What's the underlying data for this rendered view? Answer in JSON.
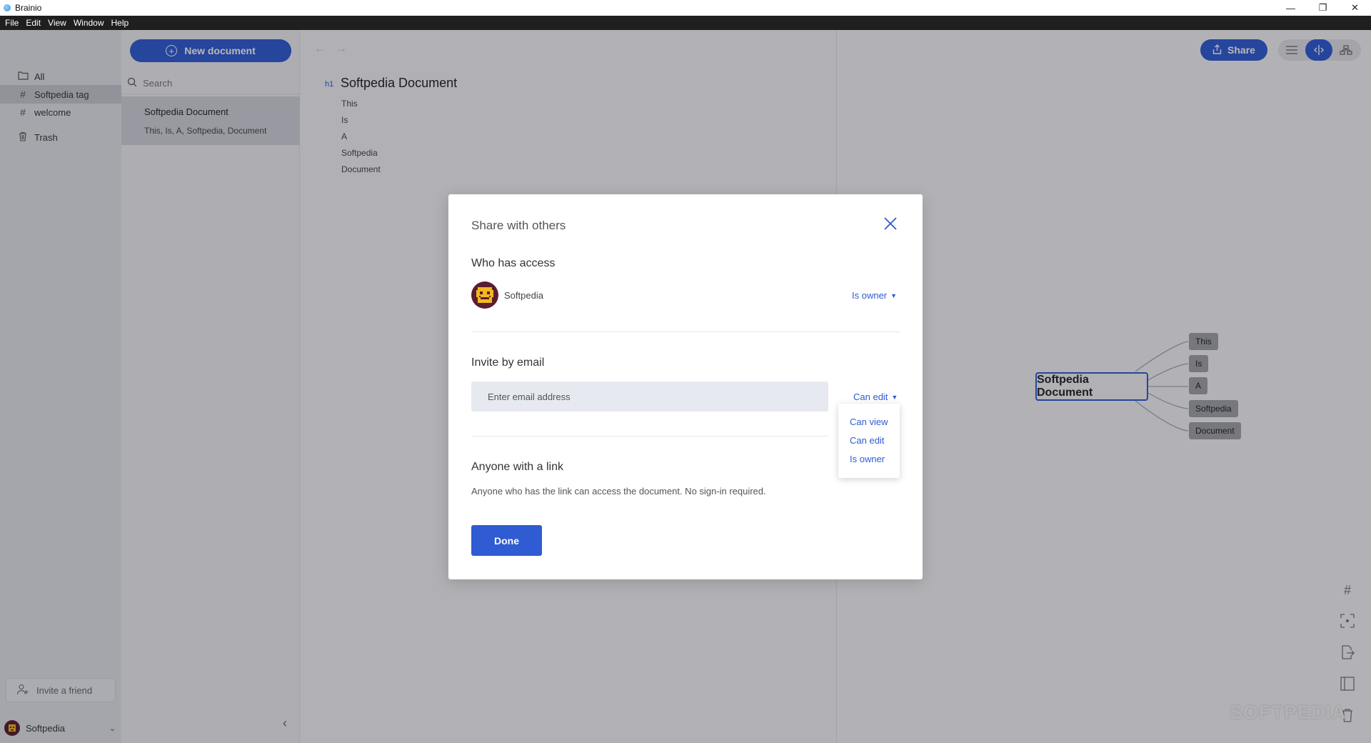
{
  "window": {
    "title": "Brainio",
    "controls": {
      "minimize": "—",
      "restore": "❐",
      "close": "✕"
    }
  },
  "menu": [
    "File",
    "Edit",
    "View",
    "Window",
    "Help"
  ],
  "sidebar": {
    "items": [
      {
        "label": "All",
        "icon": "folder-icon",
        "active": false
      },
      {
        "label": "Softpedia tag",
        "icon": "hash-icon",
        "active": true
      },
      {
        "label": "welcome",
        "icon": "hash-icon",
        "active": false
      },
      {
        "label": "Trash",
        "icon": "trash-icon",
        "active": false
      }
    ],
    "invite_label": "Invite a friend",
    "user_name": "Softpedia"
  },
  "docs": {
    "new_document_label": "New document",
    "search_placeholder": "Search",
    "items": [
      {
        "title": "Softpedia Document",
        "subtitle": "This, Is, A, Softpedia, Document"
      }
    ]
  },
  "editor": {
    "heading_tag": "h1",
    "title": "Softpedia Document",
    "lines": [
      "This",
      "Is",
      "A",
      "Softpedia",
      "Document"
    ]
  },
  "mindmap": {
    "share_label": "Share",
    "root": "Softpedia Document",
    "children": [
      "This",
      "Is",
      "A",
      "Softpedia",
      "Document"
    ],
    "watermark": "SOFTPEDIA"
  },
  "modal": {
    "title": "Share with others",
    "who_has_access_label": "Who has access",
    "owner": {
      "name": "Softpedia",
      "role": "Is owner"
    },
    "invite_label": "Invite by email",
    "email_placeholder": "Enter email address",
    "invite_role": "Can edit",
    "role_options": [
      "Can view",
      "Can edit",
      "Is owner"
    ],
    "link_label": "Anyone with a link",
    "link_description": "Anyone who has the link can access the document. No sign-in required.",
    "done_label": "Done"
  },
  "colors": {
    "accent": "#2f5bd3",
    "sidebar_bg": "#e4e5e9",
    "node_bg": "#a3a4a8"
  }
}
